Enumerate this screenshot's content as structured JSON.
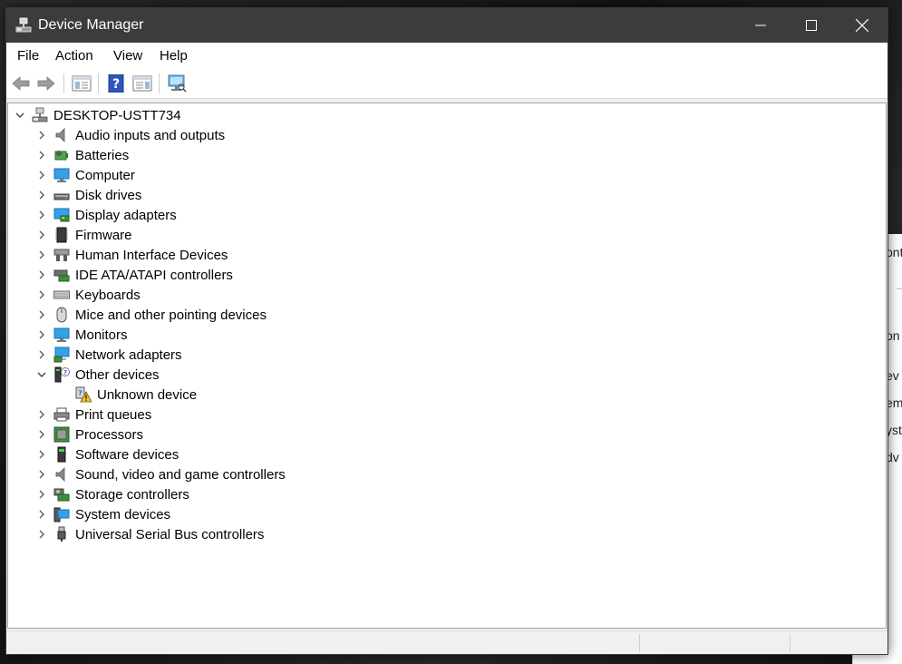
{
  "window": {
    "title": "Device Manager",
    "title_bar_color": "#3c3c3c"
  },
  "menu": [
    "File",
    "Action",
    "View",
    "Help"
  ],
  "toolbar": {
    "buttons": [
      "back-arrow-icon",
      "forward-arrow-icon",
      "properties-icon",
      "help-icon",
      "details-pane-icon",
      "scan-hardware-icon"
    ]
  },
  "tree": {
    "root": "DESKTOP-USTT734",
    "items": [
      {
        "label": "Audio inputs and outputs",
        "icon": "speaker-icon",
        "expanded": false
      },
      {
        "label": "Batteries",
        "icon": "battery-icon",
        "expanded": false
      },
      {
        "label": "Computer",
        "icon": "computer-icon",
        "expanded": false
      },
      {
        "label": "Disk drives",
        "icon": "disk-drive-icon",
        "expanded": false
      },
      {
        "label": "Display adapters",
        "icon": "display-adapter-icon",
        "expanded": false
      },
      {
        "label": "Firmware",
        "icon": "firmware-chip-icon",
        "expanded": false
      },
      {
        "label": "Human Interface Devices",
        "icon": "hid-icon",
        "expanded": false
      },
      {
        "label": "IDE ATA/ATAPI controllers",
        "icon": "ide-controller-icon",
        "expanded": false
      },
      {
        "label": "Keyboards",
        "icon": "keyboard-icon",
        "expanded": false
      },
      {
        "label": "Mice and other pointing devices",
        "icon": "mouse-icon",
        "expanded": false
      },
      {
        "label": "Monitors",
        "icon": "monitor-icon",
        "expanded": false
      },
      {
        "label": "Network adapters",
        "icon": "network-adapter-icon",
        "expanded": false
      },
      {
        "label": "Other devices",
        "icon": "other-devices-icon",
        "expanded": true,
        "children": [
          {
            "label": "Unknown device",
            "icon": "unknown-device-warning-icon"
          }
        ]
      },
      {
        "label": "Print queues",
        "icon": "printer-icon",
        "expanded": false
      },
      {
        "label": "Processors",
        "icon": "processor-icon",
        "expanded": false
      },
      {
        "label": "Software devices",
        "icon": "software-device-icon",
        "expanded": false
      },
      {
        "label": "Sound, video and game controllers",
        "icon": "sound-controller-icon",
        "expanded": false
      },
      {
        "label": "Storage controllers",
        "icon": "storage-controller-icon",
        "expanded": false
      },
      {
        "label": "System devices",
        "icon": "system-devices-icon",
        "expanded": false
      },
      {
        "label": "Universal Serial Bus controllers",
        "icon": "usb-icon",
        "expanded": false
      }
    ]
  },
  "background_window": {
    "fragments": [
      "ont",
      "on",
      "ev",
      "em",
      "yst",
      "dv"
    ]
  }
}
